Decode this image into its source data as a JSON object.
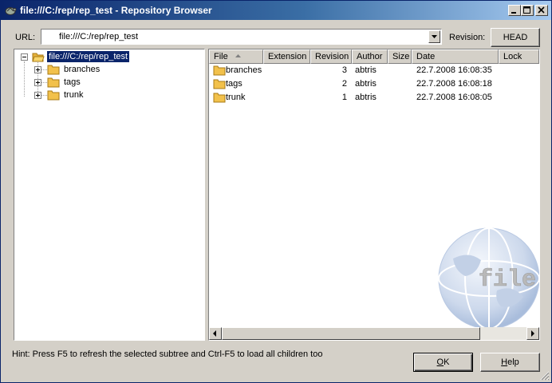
{
  "window": {
    "title": "file:///C:/rep/rep_test - Repository Browser",
    "title_icon": "tortoise-icon"
  },
  "toolbar": {
    "url_label": "URL:",
    "url_value": "file:///C:/rep/rep_test",
    "revision_label": "Revision:",
    "revision_button": "HEAD"
  },
  "tree": {
    "root": {
      "label": "file:///C:/rep/rep_test",
      "selected": true
    },
    "children": [
      {
        "label": "branches"
      },
      {
        "label": "tags"
      },
      {
        "label": "trunk"
      }
    ]
  },
  "list": {
    "columns": [
      "File",
      "Extension",
      "Revision",
      "Author",
      "Size",
      "Date",
      "Lock"
    ],
    "sort_column": "File",
    "sort_direction": "ascending",
    "rows": [
      {
        "file": "branches",
        "extension": "",
        "revision": "3",
        "author": "abtris",
        "size": "",
        "date": "22.7.2008 16:08:35",
        "lock": ""
      },
      {
        "file": "tags",
        "extension": "",
        "revision": "2",
        "author": "abtris",
        "size": "",
        "date": "22.7.2008 16:08:18",
        "lock": ""
      },
      {
        "file": "trunk",
        "extension": "",
        "revision": "1",
        "author": "abtris",
        "size": "",
        "date": "22.7.2008 16:08:05",
        "lock": ""
      }
    ],
    "watermark": {
      "text": "file",
      "icon": "globe-icon"
    }
  },
  "footer": {
    "hint": "Hint: Press F5 to refresh the selected subtree and Ctrl-F5 to load all children too",
    "ok_label_accel": "O",
    "ok_label_rest": "K",
    "help_label_accel": "H",
    "help_label_rest": "elp"
  },
  "colors": {
    "titlebar_start": "#0a246a",
    "titlebar_end": "#a6caf0",
    "selection": "#0a246a",
    "folder": "#f2c14b",
    "face": "#d4d0c8"
  }
}
